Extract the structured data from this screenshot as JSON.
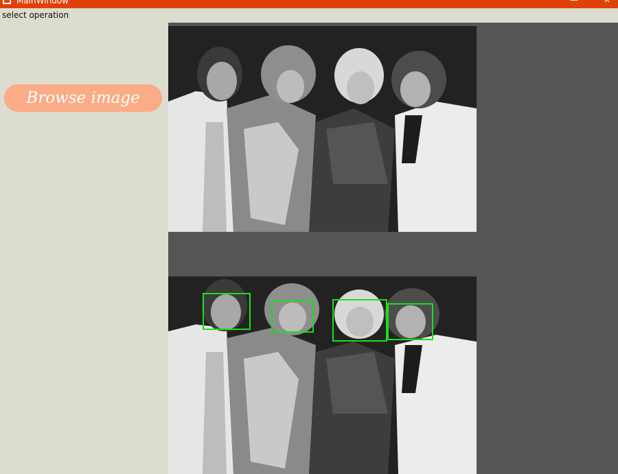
{
  "window": {
    "title": "MainWindow",
    "minimize_glyph": "—",
    "close_glyph": "✕",
    "titlebar_color": "#e0410a"
  },
  "status": {
    "label": "select operation"
  },
  "browse": {
    "label": "Browse image",
    "color": "#fbab85"
  },
  "display": {
    "background": "#555555",
    "original_image": "grayscale-group-photo",
    "detected_image": "grayscale-group-photo-with-face-boxes",
    "face_box_color": "#19e119"
  }
}
